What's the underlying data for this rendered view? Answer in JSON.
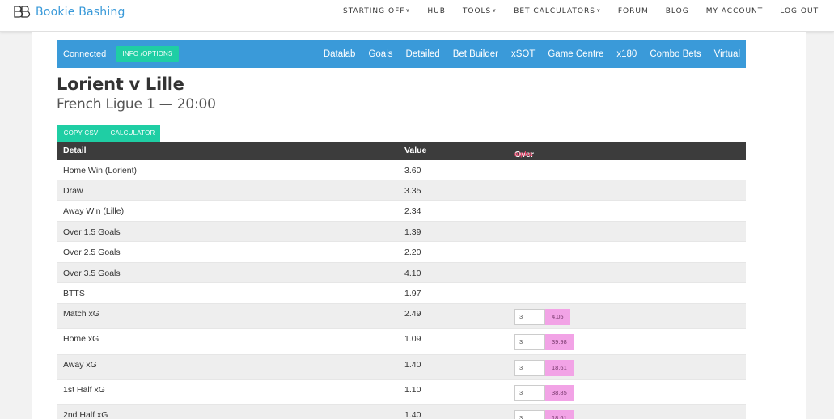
{
  "brand": {
    "name": "Bookie Bashing"
  },
  "topnav": [
    {
      "label": "STARTING OFF",
      "dropdown": true
    },
    {
      "label": "HUB",
      "dropdown": false
    },
    {
      "label": "TOOLS",
      "dropdown": true
    },
    {
      "label": "BET CALCULATORS",
      "dropdown": true
    },
    {
      "label": "FORUM",
      "dropdown": false
    },
    {
      "label": "BLOG",
      "dropdown": false
    },
    {
      "label": "MY ACCOUNT",
      "dropdown": false
    },
    {
      "label": "LOG OUT",
      "dropdown": false
    }
  ],
  "bluebar": {
    "status": "Connected",
    "info_button": "INFO /OPTIONS",
    "links": [
      "Datalab",
      "Goals",
      "Detailed",
      "Bet Builder",
      "xSOT",
      "Game Centre",
      "x180",
      "Combo Bets",
      "Virtual"
    ]
  },
  "match": {
    "title": "Lorient v Lille",
    "subtitle": "French Ligue 1 — 20:00"
  },
  "buttons": {
    "copy_csv": "COPY CSV",
    "calculator": "CALCULATOR"
  },
  "table": {
    "headers": {
      "detail": "Detail",
      "value": "Value",
      "over": "Over",
      "over_tag": "alpha"
    },
    "rows": [
      {
        "detail": "Home Win (Lorient)",
        "value": "3.60"
      },
      {
        "detail": "Draw",
        "value": "3.35"
      },
      {
        "detail": "Away Win (Lille)",
        "value": "2.34"
      },
      {
        "detail": "Over 1.5 Goals",
        "value": "1.39"
      },
      {
        "detail": "Over 2.5 Goals",
        "value": "2.20"
      },
      {
        "detail": "Over 3.5 Goals",
        "value": "4.10"
      },
      {
        "detail": "BTTS",
        "value": "1.97"
      },
      {
        "detail": "Match xG",
        "value": "2.49",
        "over_input": "3",
        "over_result": "4.05"
      },
      {
        "detail": "Home xG",
        "value": "1.09",
        "over_input": "3",
        "over_result": "39.98"
      },
      {
        "detail": "Away xG",
        "value": "1.40",
        "over_input": "3",
        "over_result": "18.61"
      },
      {
        "detail": "1st Half xG",
        "value": "1.10",
        "over_input": "3",
        "over_result": "38.85"
      },
      {
        "detail": "2nd Half xG",
        "value": "1.40",
        "over_input": "3",
        "over_result": "18.61"
      }
    ]
  },
  "colors": {
    "accent": "#3a9ad9",
    "button": "#1fcea4",
    "header": "#3c3c3c",
    "highlight": "#f2a3e6",
    "alpha": "#e8436a"
  }
}
